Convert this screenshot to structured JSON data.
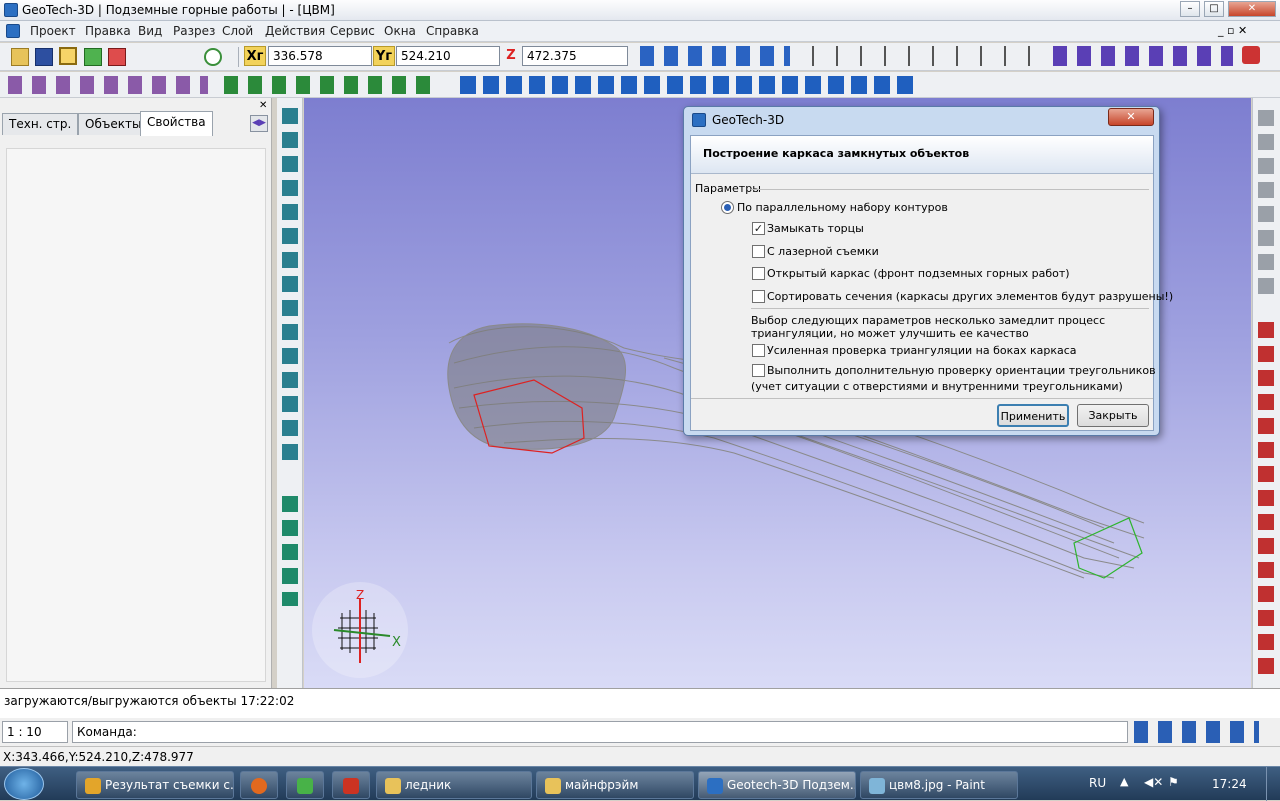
{
  "window": {
    "title": "GeoTech-3D | Подземные горные работы | - [ЦВМ]"
  },
  "menu": [
    "Проект",
    "Правка",
    "Вид",
    "Разрез",
    "Слой",
    "Действия",
    "Сервис",
    "Окна",
    "Справка"
  ],
  "coords": {
    "x_label": "Xг",
    "x_value": "336.578",
    "y_label": "Yг",
    "y_value": "524.210",
    "z_label": "Z",
    "z_value": "472.375"
  },
  "left_panel": {
    "tabs": [
      "Техн. стр.",
      "Объекты",
      "Свойства"
    ],
    "active_tab": "Свойства"
  },
  "axis": {
    "z": "Z",
    "x": "X"
  },
  "dialog": {
    "title": "GeoTech-3D",
    "header": "Построение каркаса замкнутых объектов",
    "group": "Параметры",
    "radio_label": "По параллельному набору контуров",
    "options": [
      {
        "label": "Замыкать торцы",
        "checked": true
      },
      {
        "label": "С лазерной съемки",
        "checked": false
      },
      {
        "label": "Открытый каркас (фронт подземных горных работ)",
        "checked": false
      },
      {
        "label": "Сортировать сечения (каркасы других элементов будут разрушены!)",
        "checked": false
      }
    ],
    "note": "Выбор следующих параметров несколько замедлит процесс триангуляции, но может улучшить ее  качество",
    "opt2": [
      {
        "label": "Усиленная проверка триангуляции на боках каркаса",
        "checked": false
      },
      {
        "label": "Выполнить дополнительную проверку ориентации треугольников",
        "checked": false
      }
    ],
    "opt2_sub": "(учет ситуации с отверстиями и внутренними треугольниками)",
    "apply": "Применить",
    "close": "Закрыть"
  },
  "message": "загружаются/выгружаются объекты 17:22:02",
  "scale": "1 : 10",
  "command_label": "Команда:",
  "status_coords": "X:343.466,Y:524.210,Z:478.977",
  "taskbar": {
    "tasks": [
      "Результат съемки с...",
      "",
      "",
      "",
      "ледник",
      "майнфрэйм",
      "Geotech-3D Подзем...",
      "цвм8.jpg - Paint"
    ],
    "lang": "RU",
    "time": "17:24"
  }
}
